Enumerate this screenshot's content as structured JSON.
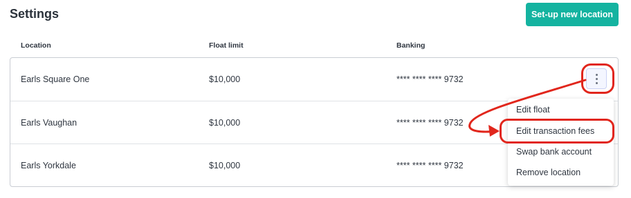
{
  "page": {
    "title": "Settings",
    "new_location_label": "Set-up new location"
  },
  "table": {
    "headers": {
      "location": "Location",
      "float_limit": "Float limit",
      "banking": "Banking"
    },
    "rows": [
      {
        "location": "Earls Square One",
        "float_limit": "$10,000",
        "banking": "**** **** **** 9732"
      },
      {
        "location": "Earls Vaughan",
        "float_limit": "$10,000",
        "banking": "**** **** **** 9732"
      },
      {
        "location": "Earls Yorkdale",
        "float_limit": "$10,000",
        "banking": "**** **** **** 9732"
      }
    ]
  },
  "menu": {
    "items": [
      {
        "label": "Edit float"
      },
      {
        "label": "Edit transaction fees"
      },
      {
        "label": "Swap bank account"
      },
      {
        "label": "Remove location"
      }
    ]
  },
  "colors": {
    "primary": "#14b3a0",
    "annotation": "#e1261c"
  },
  "icons": {
    "row_actions": "kebab-menu-icon"
  }
}
